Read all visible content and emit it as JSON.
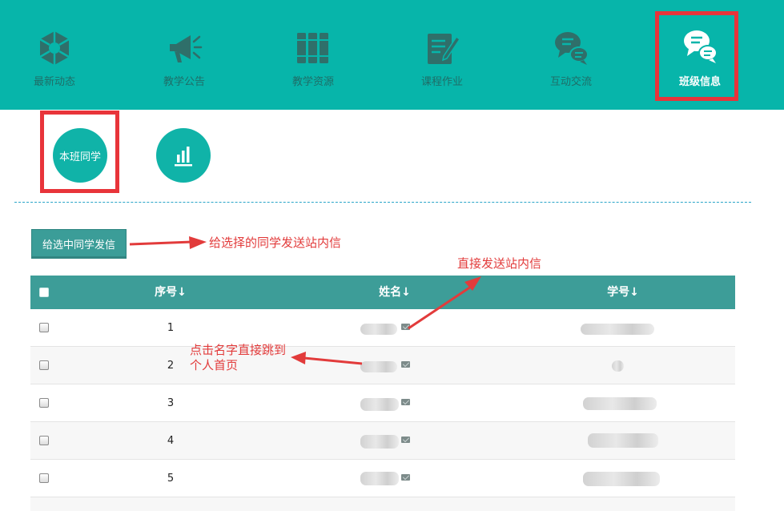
{
  "nav": {
    "items": [
      {
        "label": "最新动态",
        "icon": "puzzle-icon"
      },
      {
        "label": "教学公告",
        "icon": "megaphone-icon"
      },
      {
        "label": "教学资源",
        "icon": "books-icon"
      },
      {
        "label": "课程作业",
        "icon": "edit-note-icon"
      },
      {
        "label": "互动交流",
        "icon": "chat-bubbles-icon"
      },
      {
        "label": "班级信息",
        "icon": "chat-bubbles-icon"
      }
    ],
    "active_index": 5
  },
  "subtabs": {
    "classmates_label": "本班同学",
    "stats_icon": "bar-chart-icon"
  },
  "send_button_label": "给选中同学发信",
  "table": {
    "headers": {
      "index": "序号↓",
      "name": "姓名↓",
      "student_id": "学号↓"
    },
    "rows": [
      {
        "index": "1"
      },
      {
        "index": "2"
      },
      {
        "index": "3"
      },
      {
        "index": "4"
      },
      {
        "index": "5"
      }
    ]
  },
  "annotations": {
    "send_selected": "给选择的同学发送站内信",
    "send_direct": "直接发送站内信",
    "click_name_line1": "点击名字直接跳到",
    "click_name_line2": "个人首页"
  },
  "colors": {
    "nav_bg": "#07b5aa",
    "header_bg": "#3d9d98",
    "highlight_red": "#e8343a",
    "annotation_red": "#e23b3b",
    "divider": "#2aa5c9"
  }
}
